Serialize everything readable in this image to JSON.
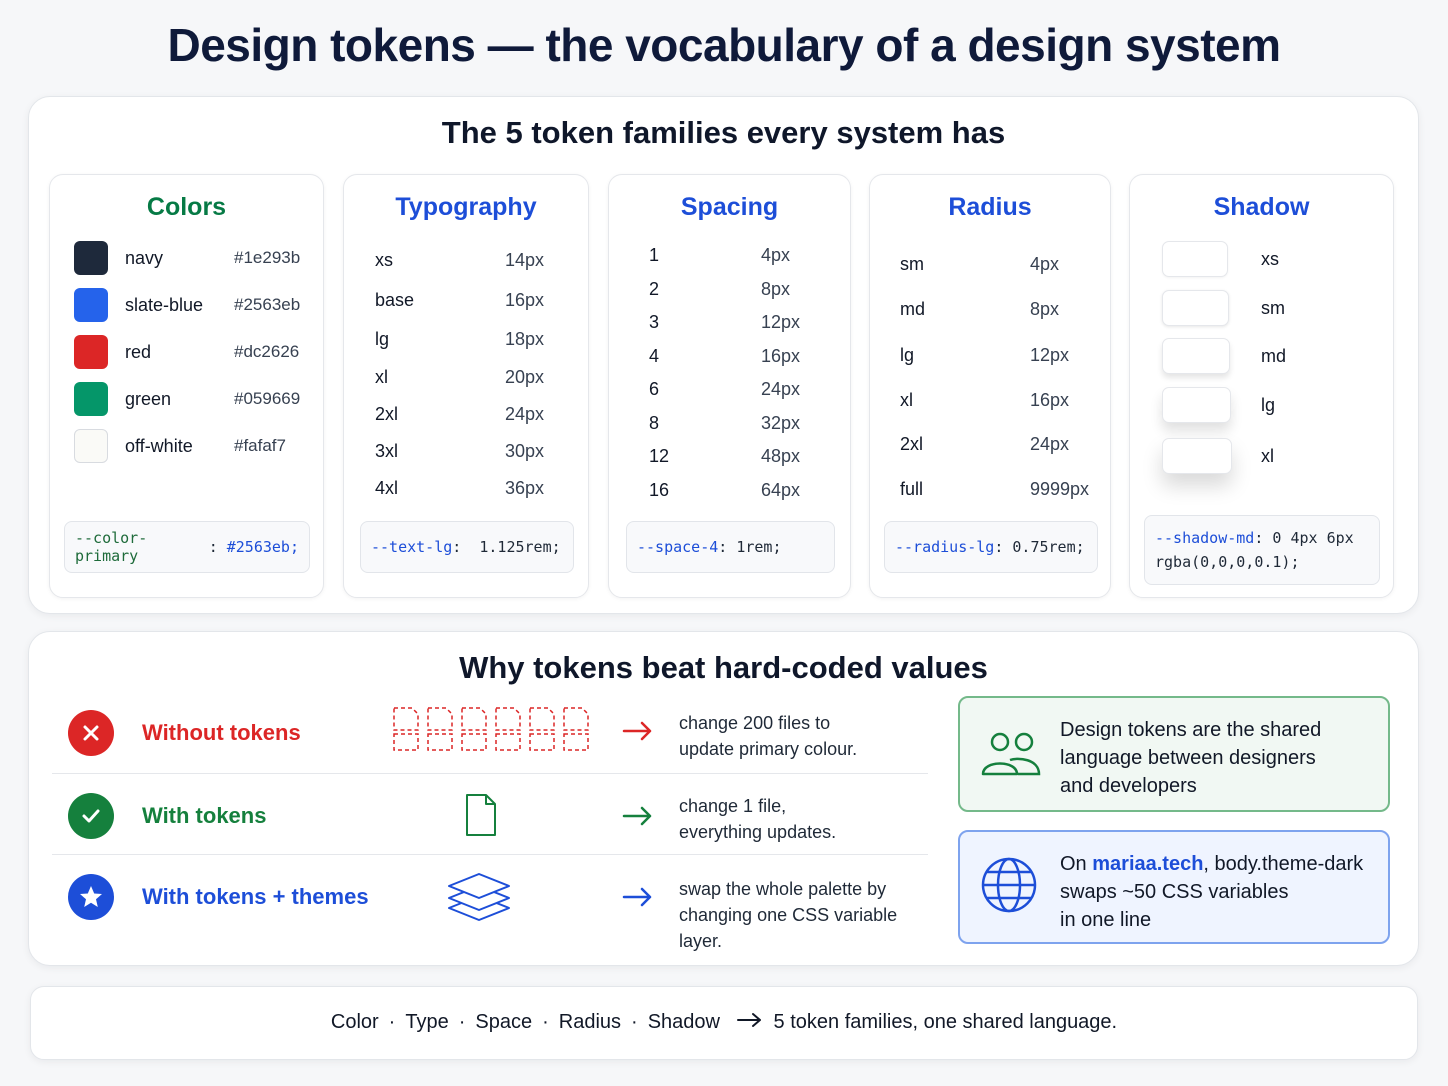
{
  "title": "Design tokens — the vocabulary of a design system",
  "families": {
    "heading": "The 5 token families every system has",
    "colors": {
      "title": "Colors",
      "items": [
        {
          "name": "navy",
          "hex": "#1e293b"
        },
        {
          "name": "slate-blue",
          "hex": "#2563eb"
        },
        {
          "name": "red",
          "hex": "#dc2626"
        },
        {
          "name": "green",
          "hex": "#059669"
        },
        {
          "name": "off-white",
          "hex": "#fafaf7"
        }
      ],
      "code_prop": "--color-primary",
      "code_sep": ":",
      "code_value": "#2563eb;"
    },
    "typography": {
      "title": "Typography",
      "items": [
        {
          "name": "xs",
          "value": "14px"
        },
        {
          "name": "base",
          "value": "16px"
        },
        {
          "name": "lg",
          "value": "18px"
        },
        {
          "name": "xl",
          "value": "20px"
        },
        {
          "name": "2xl",
          "value": "24px"
        },
        {
          "name": "3xl",
          "value": "30px"
        },
        {
          "name": "4xl",
          "value": "36px"
        }
      ],
      "code_prop": "--text-lg",
      "code_sep": ":",
      "code_value": "1.125rem;"
    },
    "spacing": {
      "title": "Spacing",
      "items": [
        {
          "name": "1",
          "value": "4px"
        },
        {
          "name": "2",
          "value": "8px"
        },
        {
          "name": "3",
          "value": "12px"
        },
        {
          "name": "4",
          "value": "16px"
        },
        {
          "name": "6",
          "value": "24px"
        },
        {
          "name": "8",
          "value": "32px"
        },
        {
          "name": "12",
          "value": "48px"
        },
        {
          "name": "16",
          "value": "64px"
        }
      ],
      "code_prop": "--space-4",
      "code_sep": ":",
      "code_value": "1rem;"
    },
    "radius": {
      "title": "Radius",
      "items": [
        {
          "name": "sm",
          "value": "4px"
        },
        {
          "name": "md",
          "value": "8px"
        },
        {
          "name": "lg",
          "value": "12px"
        },
        {
          "name": "xl",
          "value": "16px"
        },
        {
          "name": "2xl",
          "value": "24px"
        },
        {
          "name": "full",
          "value": "9999px"
        }
      ],
      "code_prop": "--radius-lg",
      "code_sep": ":",
      "code_value": "0.75rem;"
    },
    "shadow": {
      "title": "Shadow",
      "items": [
        {
          "name": "xs"
        },
        {
          "name": "sm"
        },
        {
          "name": "md"
        },
        {
          "name": "lg"
        },
        {
          "name": "xl"
        }
      ],
      "code_prop": "--shadow-md",
      "code_line1_rest": ": 0 4px 6px",
      "code_line2": "rgba(0,0,0,0.1);"
    }
  },
  "why": {
    "heading": "Why tokens beat hard-coded values",
    "rows": [
      {
        "label": "Without tokens",
        "desc_line1": "change 200 files to",
        "desc_line2": "update primary colour.",
        "color": "#dc2626",
        "icon": "x-circle-icon"
      },
      {
        "label": "With tokens",
        "desc_line1": "change 1 file,",
        "desc_line2": "everything updates.",
        "color": "#15803d",
        "icon": "check-circle-icon"
      },
      {
        "label": "With tokens + themes",
        "desc_line1": "swap the whole palette by",
        "desc_line2": "changing one CSS variable layer.",
        "color": "#1d4ed8",
        "icon": "star-circle-icon"
      }
    ],
    "callout_shared": {
      "line1": "Design tokens are the shared",
      "line2": "language between designers",
      "line3": "and developers",
      "icon": "people-icon"
    },
    "callout_site": {
      "prefix": "On ",
      "link": "mariaa.tech",
      "line1_rest": ", body.theme-dark",
      "line2": "swaps ~50 CSS variables",
      "line3": "in one line",
      "icon": "globe-icon"
    }
  },
  "footer": {
    "items": [
      "Color",
      "Type",
      "Space",
      "Radius",
      "Shadow"
    ],
    "separator": "·",
    "summary": "5 token families, one shared language."
  }
}
